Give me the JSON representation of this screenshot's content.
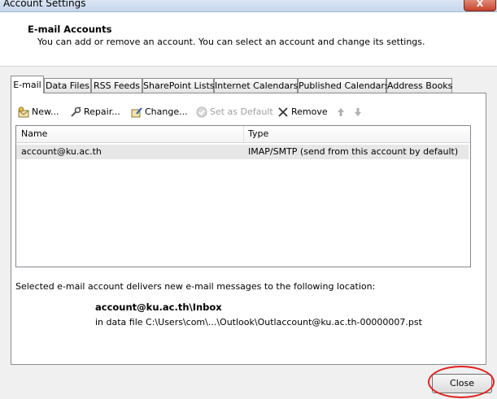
{
  "window": {
    "title": "Account Settings",
    "close_glyph": "X"
  },
  "header": {
    "title": "E-mail Accounts",
    "subtitle": "You can add or remove an account. You can select an account and change its settings."
  },
  "tabs": [
    {
      "label": "E-mail",
      "active": true
    },
    {
      "label": "Data Files"
    },
    {
      "label": "RSS Feeds"
    },
    {
      "label": "SharePoint Lists"
    },
    {
      "label": "Internet Calendars"
    },
    {
      "label": "Published Calendars"
    },
    {
      "label": "Address Books"
    }
  ],
  "toolbar": {
    "new_label": "New...",
    "repair_label": "Repair...",
    "change_label": "Change...",
    "set_default_label": "Set as Default",
    "remove_label": "Remove"
  },
  "accounts": {
    "columns": [
      "Name",
      "Type"
    ],
    "rows": [
      {
        "name": "account@ku.ac.th",
        "type": "IMAP/SMTP (send from this account by default)"
      }
    ]
  },
  "delivery": {
    "description": "Selected e-mail account delivers new e-mail messages to the following location:",
    "location": "account@ku.ac.th\\Inbox",
    "data_file": "in data file C:\\Users\\com\\...\\Outlook\\Outlaccount@ku.ac.th-00000007.pst"
  },
  "footer": {
    "close_label": "Close"
  },
  "colors": {
    "highlight_circle": "#e0201e",
    "selected_row": "#e7e7e7"
  }
}
